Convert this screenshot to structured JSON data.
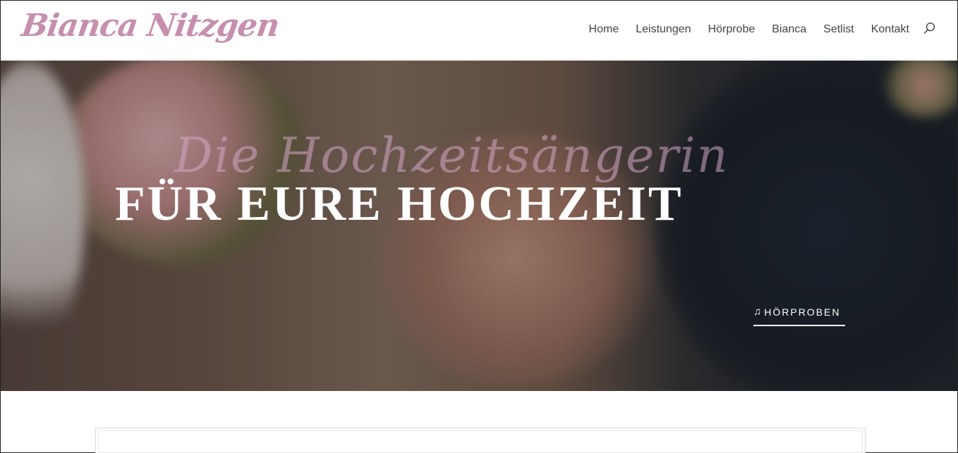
{
  "header": {
    "logo_text": "Bianca Nitzgen",
    "nav": [
      {
        "label": "Home"
      },
      {
        "label": "Leistungen"
      },
      {
        "label": "Hörprobe"
      },
      {
        "label": "Bianca"
      },
      {
        "label": "Setlist"
      },
      {
        "label": "Kontakt"
      }
    ],
    "search_icon": "search-icon"
  },
  "hero": {
    "script_title": "Die Hochzeitsängerin",
    "main_title": "FÜR EURE HOCHZEIT",
    "cta_icon": "music-note-icon",
    "cta_label": "HÖRPROBEN"
  },
  "colors": {
    "brand_pink": "#c68fae",
    "nav_text": "#444444",
    "hero_text": "#ffffff"
  }
}
